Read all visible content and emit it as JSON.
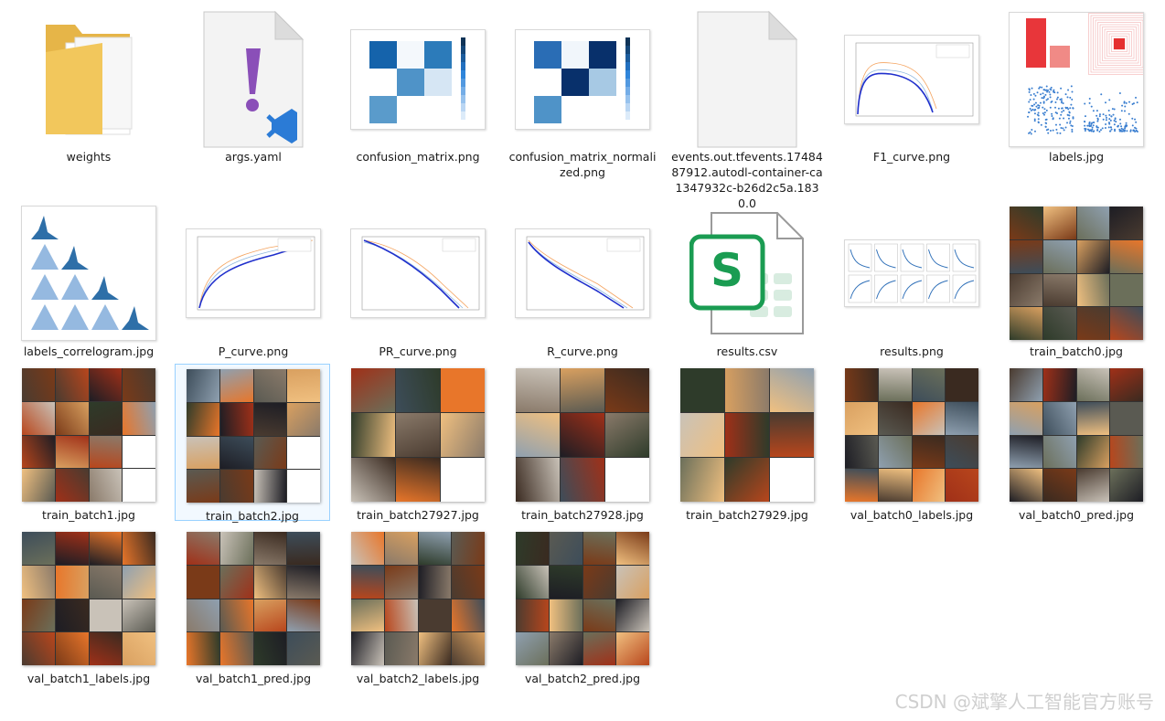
{
  "files": [
    {
      "name": "weights",
      "kind": "folder"
    },
    {
      "name": "args.yaml",
      "kind": "yaml"
    },
    {
      "name": "confusion_matrix.png",
      "kind": "confusion"
    },
    {
      "name": "confusion_matrix_normalized.png",
      "kind": "confusion"
    },
    {
      "name": "events.out.tfevents.1748487912.autodl-container-ca1347932c-b26d2c5a.1830.0",
      "kind": "blank"
    },
    {
      "name": "F1_curve.png",
      "kind": "curve"
    },
    {
      "name": "labels.jpg",
      "kind": "labels"
    },
    {
      "name": "labels_correlogram.jpg",
      "kind": "correlogram"
    },
    {
      "name": "P_curve.png",
      "kind": "curve"
    },
    {
      "name": "PR_curve.png",
      "kind": "curve"
    },
    {
      "name": "R_curve.png",
      "kind": "curve"
    },
    {
      "name": "results.csv",
      "kind": "csv"
    },
    {
      "name": "results.png",
      "kind": "results"
    },
    {
      "name": "train_batch0.jpg",
      "kind": "mosaic"
    },
    {
      "name": "train_batch1.jpg",
      "kind": "mosaic"
    },
    {
      "name": "train_batch2.jpg",
      "kind": "mosaic"
    },
    {
      "name": "train_batch27927.jpg",
      "kind": "mosaic"
    },
    {
      "name": "train_batch27928.jpg",
      "kind": "mosaic"
    },
    {
      "name": "train_batch27929.jpg",
      "kind": "mosaic"
    },
    {
      "name": "val_batch0_labels.jpg",
      "kind": "mosaic"
    },
    {
      "name": "val_batch0_pred.jpg",
      "kind": "mosaic"
    },
    {
      "name": "val_batch1_labels.jpg",
      "kind": "mosaic"
    },
    {
      "name": "val_batch1_pred.jpg",
      "kind": "mosaic"
    },
    {
      "name": "val_batch2_labels.jpg",
      "kind": "mosaic"
    },
    {
      "name": "val_batch2_pred.jpg",
      "kind": "mosaic"
    }
  ],
  "selected": "train_batch2.jpg",
  "watermark": "CSDN @斌擎人工智能官方账号",
  "colors": {
    "folder": "#f2c75c",
    "vscode": "#2b7bd6",
    "yaml_mark": "#8a4fb8",
    "excel": "#1a9c52",
    "fire": "#e8542a"
  }
}
